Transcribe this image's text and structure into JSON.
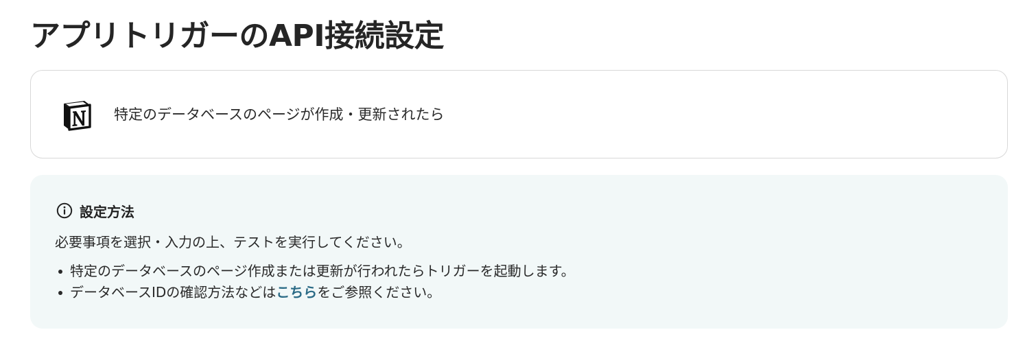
{
  "header": {
    "title": "アプリトリガーのAPI接続設定"
  },
  "trigger": {
    "app_icon": "notion-logo-icon",
    "label": "特定のデータベースのページが作成・更新されたら"
  },
  "info": {
    "icon": "info-circle-icon",
    "title": "設定方法",
    "intro": "必要事項を選択・入力の上、テストを実行してください。",
    "items": [
      {
        "text": "特定のデータベースのページ作成または更新が行われたらトリガーを起動します。"
      },
      {
        "before_link": "データベースIDの確認方法などは",
        "link_text": "こちら",
        "after_link": "をご参照ください。"
      }
    ]
  },
  "colors": {
    "link": "#2b6b86",
    "panel_background": "#f2f8f8",
    "card_border": "#d8d8d8"
  }
}
